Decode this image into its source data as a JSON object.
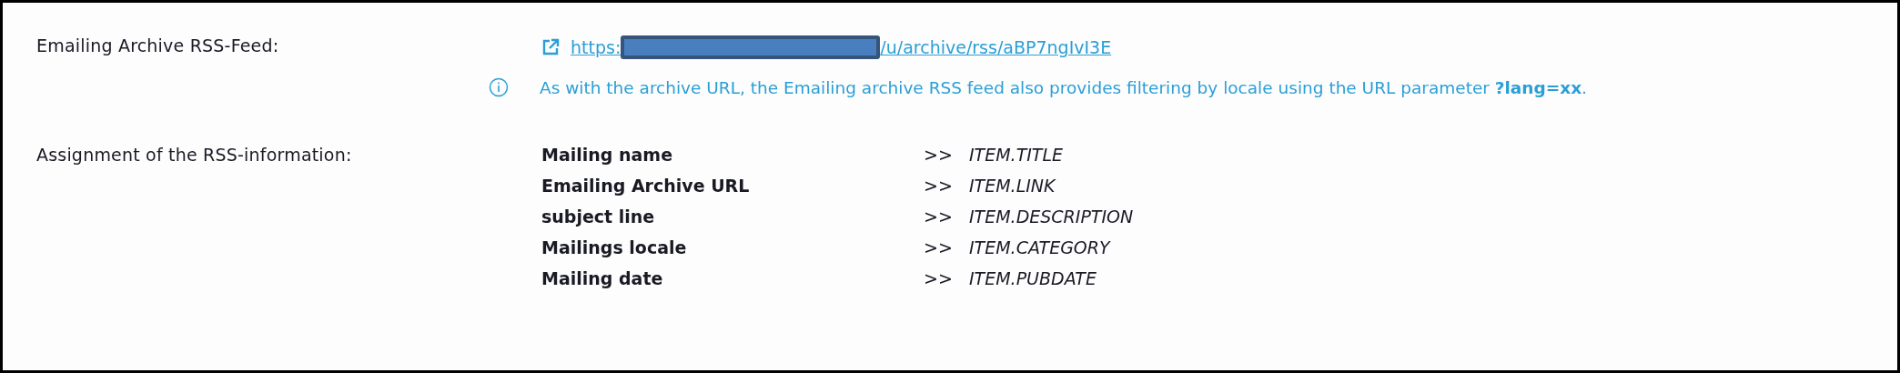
{
  "feed": {
    "label": "Emailing Archive RSS-Feed:",
    "url_start": "https:",
    "url_end": "/u/archive/rss/aBP7ngIvI3E",
    "redacted": true
  },
  "info": {
    "text": "As with the archive URL, the Emailing archive RSS feed also provides filtering by locale using the URL parameter **?lang=xx**."
  },
  "assignment": {
    "label": "Assignment of the RSS-information:",
    "rows": [
      {
        "field": "Mailing name",
        "arrow": ">>",
        "target": "ITEM.TITLE"
      },
      {
        "field": "Emailing Archive URL",
        "arrow": ">>",
        "target": "ITEM.LINK"
      },
      {
        "field": "subject line",
        "arrow": ">>",
        "target": "ITEM.DESCRIPTION"
      },
      {
        "field": "Mailings locale",
        "arrow": ">>",
        "target": "ITEM.CATEGORY"
      },
      {
        "field": "Mailing date",
        "arrow": ">>",
        "target": "ITEM.PUBDATE"
      }
    ]
  }
}
